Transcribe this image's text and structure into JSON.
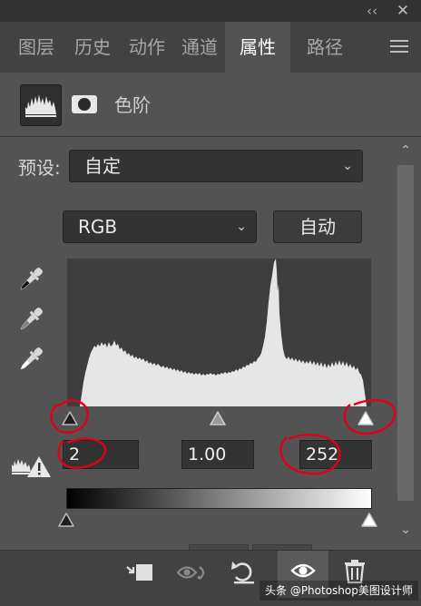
{
  "window": {
    "collapse_glyph": "‹‹",
    "close_glyph": "✕"
  },
  "tabs": [
    {
      "label": "图层",
      "active": false
    },
    {
      "label": "历史",
      "active": false
    },
    {
      "label": "动作",
      "active": false
    },
    {
      "label": "通道",
      "active": false
    },
    {
      "label": "属性",
      "active": true
    },
    {
      "label": "路径",
      "active": false
    }
  ],
  "panel": {
    "title": "色阶",
    "buttons": [
      "histogram-icon",
      "mask-icon"
    ]
  },
  "preset": {
    "label": "预设:",
    "value": "自定",
    "chevron": "⌄"
  },
  "channel": {
    "value": "RGB",
    "chevron": "⌄"
  },
  "auto_button": {
    "label": "自动"
  },
  "eyedroppers": [
    "black-point-eyedropper-icon",
    "gray-point-eyedropper-icon",
    "white-point-eyedropper-icon"
  ],
  "input_levels": {
    "black": "2",
    "gamma": "1.00",
    "white": "252"
  },
  "input_slider": {
    "black": 2,
    "gamma": 1.0,
    "white": 252,
    "max": 255
  },
  "output_levels": {
    "black": 0,
    "white": 255,
    "max": 255
  },
  "scroll": {
    "up": "⌃",
    "down": "⌄"
  },
  "bottom_toolbar": [
    "clip-to-layer-icon",
    "view-previous-state-icon",
    "reset-icon",
    "visibility-eye-icon",
    "delete-trash-icon"
  ],
  "watermark": "头条 @Photoshop美图设计师",
  "colors": {
    "panel": "#535353",
    "annotation": "#e0001b",
    "histogram_fill": "#e6e6e6"
  }
}
